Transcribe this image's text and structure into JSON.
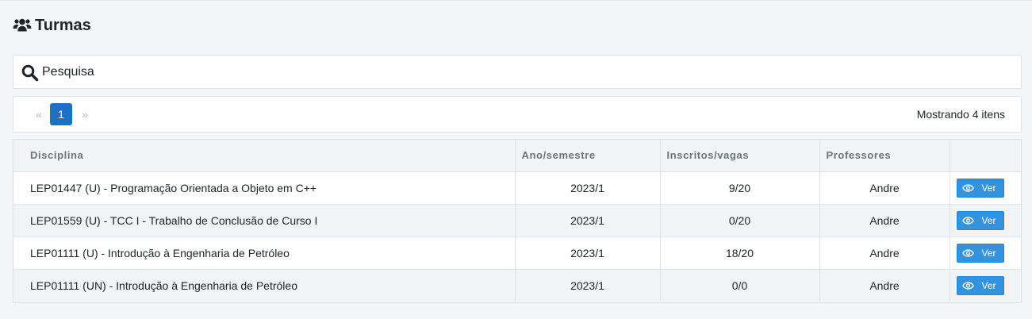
{
  "page": {
    "title": "Turmas",
    "title_icon": "users-icon"
  },
  "search": {
    "placeholder": "Pesquisa",
    "icon": "search-icon"
  },
  "pagination": {
    "prev": "«",
    "current_page": "1",
    "next": "»",
    "count_label": "Mostrando 4 itens"
  },
  "table": {
    "headers": [
      "Disciplina",
      "Ano/semestre",
      "Inscritos/vagas",
      "Professores",
      ""
    ],
    "rows": [
      {
        "disciplina": "LEP01447 (U) - Programação Orientada a Objeto em C++",
        "ano": "2023/1",
        "inscritos": "9/20",
        "professores": "Andre",
        "action": "Ver"
      },
      {
        "disciplina": "LEP01559 (U) - TCC I - Trabalho de Conclusão de Curso I",
        "ano": "2023/1",
        "inscritos": "0/20",
        "professores": "Andre",
        "action": "Ver"
      },
      {
        "disciplina": "LEP01111 (U) - Introdução à Engenharia de Petróleo",
        "ano": "2023/1",
        "inscritos": "18/20",
        "professores": "Andre",
        "action": "Ver"
      },
      {
        "disciplina": "LEP01111 (UN) - Introdução à Engenharia de Petróleo",
        "ano": "2023/1",
        "inscritos": "0/0",
        "professores": "Andre",
        "action": "Ver"
      }
    ]
  },
  "colors": {
    "primary_button": "#3592dd",
    "active_page": "#1f6fc5",
    "background": "#f3f5f8"
  }
}
